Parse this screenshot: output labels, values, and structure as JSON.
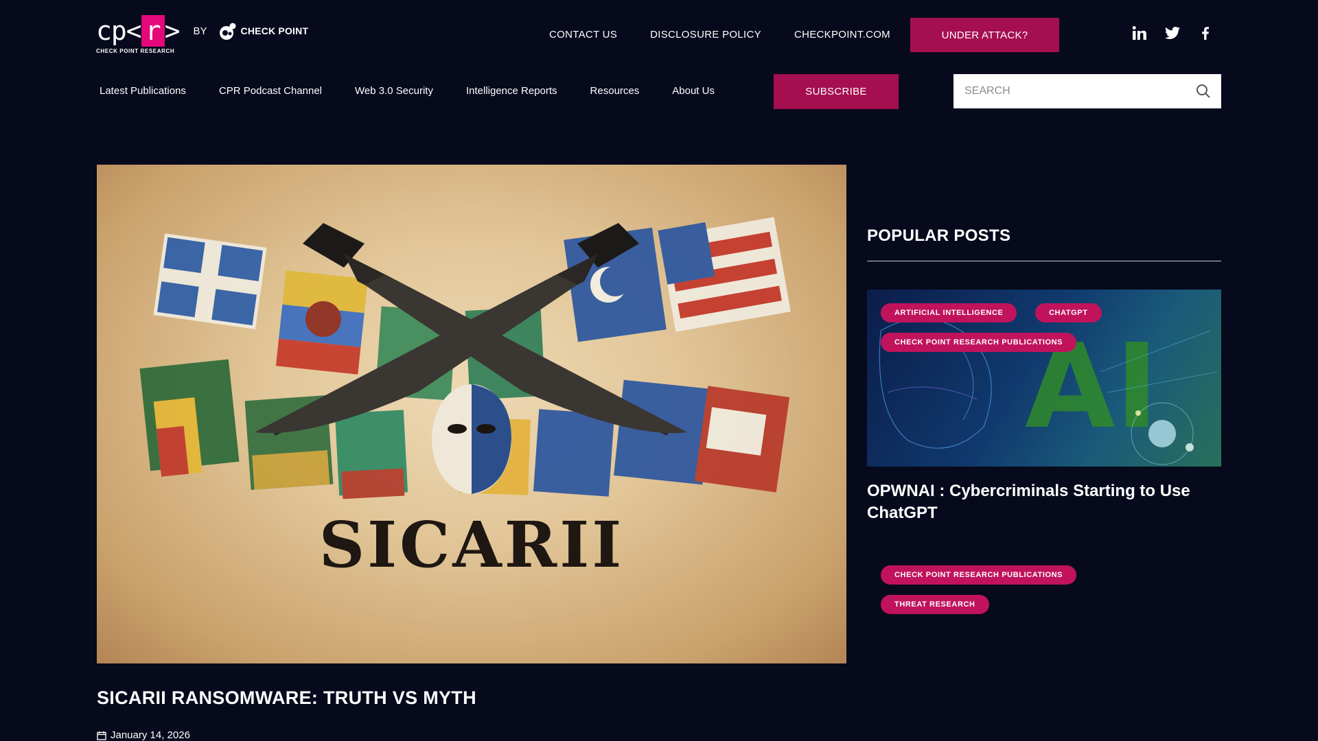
{
  "header": {
    "logo_text_left": "cp<",
    "logo_text_r": "r",
    "logo_text_right": ">",
    "logo_subtitle": "CHECK POINT RESEARCH",
    "by_label": "BY",
    "brand_name": "CHECK POINT",
    "top_links": [
      {
        "label": "CONTACT US"
      },
      {
        "label": "DISCLOSURE POLICY"
      },
      {
        "label": "CHECKPOINT.COM"
      }
    ],
    "attack_button": "UNDER ATTACK?",
    "social": [
      "linkedin-icon",
      "twitter-icon",
      "facebook-icon"
    ]
  },
  "nav": {
    "items": [
      {
        "label": "Latest Publications"
      },
      {
        "label": "CPR Podcast Channel"
      },
      {
        "label": "Web 3.0 Security"
      },
      {
        "label": "Intelligence Reports"
      },
      {
        "label": "Resources"
      },
      {
        "label": "About Us"
      }
    ],
    "subscribe": "SUBSCRIBE",
    "search_placeholder": "SEARCH"
  },
  "main": {
    "hero_word": "SICARII",
    "title": "SICARII RANSOMWARE: TRUTH VS MYTH",
    "date": "January 14, 2026"
  },
  "sidebar": {
    "heading": "POPULAR POSTS",
    "card1": {
      "tags": [
        "ARTIFICIAL INTELLIGENCE",
        "CHATGPT",
        "CHECK POINT RESEARCH PUBLICATIONS"
      ],
      "title": "OPWNAI : Cybercriminals Starting to Use ChatGPT"
    },
    "card2": {
      "tags": [
        "CHECK POINT RESEARCH PUBLICATIONS",
        "THREAT RESEARCH"
      ]
    }
  },
  "colors": {
    "background": "#070a1c",
    "accent": "#a50f4f",
    "tag": "#c0135c",
    "logo_pink": "#e4087b"
  }
}
